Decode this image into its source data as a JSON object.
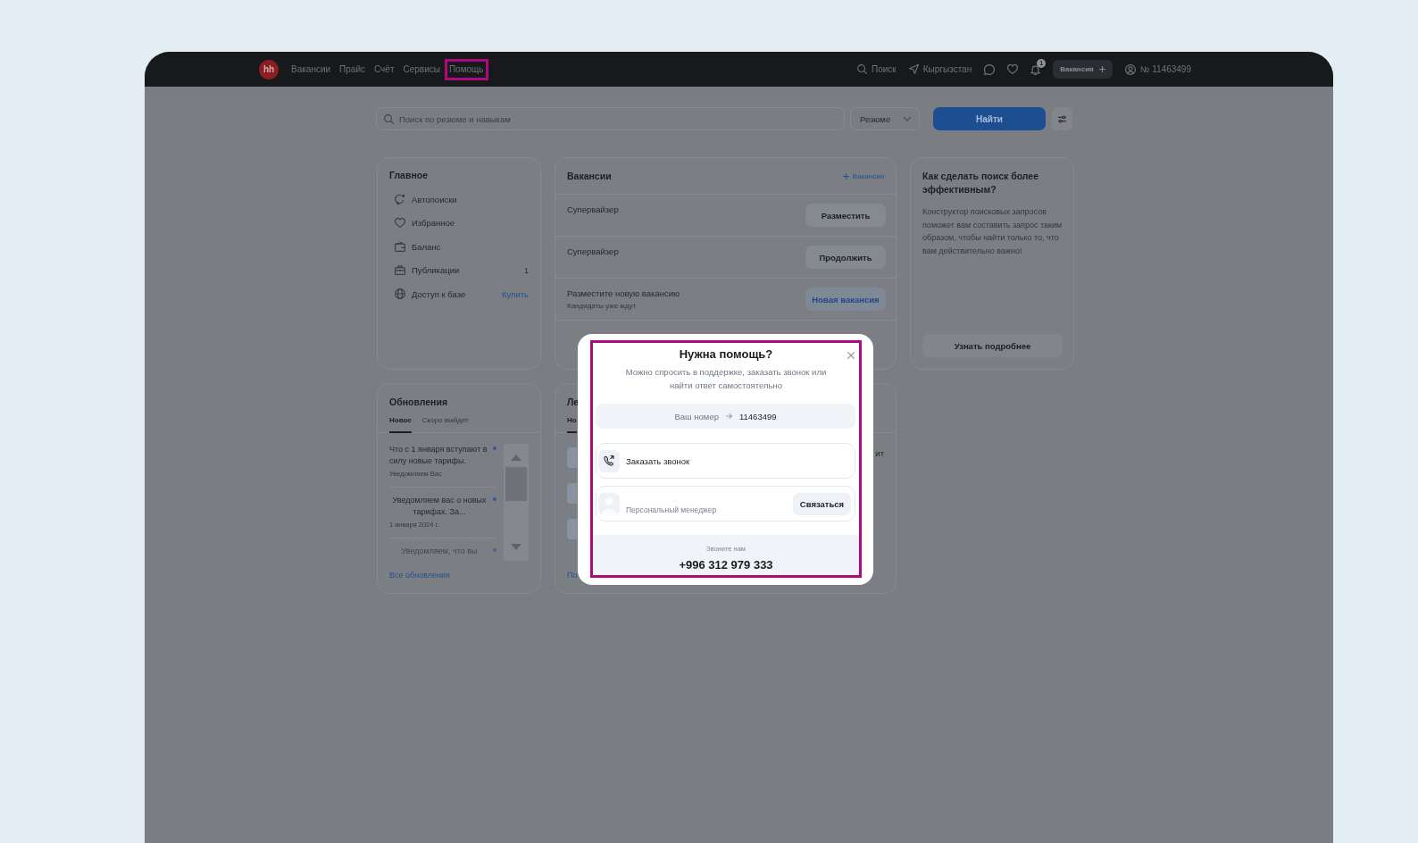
{
  "header": {
    "logo": "hh",
    "nav": [
      {
        "label": "Вакансии",
        "highlighted": false
      },
      {
        "label": "Прайс",
        "highlighted": false
      },
      {
        "label": "Счёт",
        "highlighted": false
      },
      {
        "label": "Сервисы",
        "highlighted": false
      },
      {
        "label": "Помощь",
        "highlighted": true
      }
    ],
    "search": "Поиск",
    "region": "Кыргызстан",
    "notification_count": "1",
    "vacancy_button": "Вакансия",
    "account": "№ 11463499"
  },
  "search": {
    "placeholder": "Поиск по резюме и навыкам",
    "type": "Резюме",
    "submit": "Найти"
  },
  "main_card": {
    "title": "Главное",
    "items": [
      {
        "label": "Автопоиски"
      },
      {
        "label": "Избранное"
      },
      {
        "label": "Баланс"
      },
      {
        "label": "Публикации",
        "count": "1"
      },
      {
        "label": "Доступ к базе",
        "action": "Купить"
      }
    ]
  },
  "vacancies_card": {
    "title": "Вакансии",
    "add_link": "Вакансия",
    "rows": [
      {
        "title": "Супервайзер",
        "button": "Разместить",
        "accent": false
      },
      {
        "title": "Супервайзер",
        "button": "Продолжить",
        "accent": false
      },
      {
        "title": "Разместите новую вакансию",
        "subtitle": "Кандидаты уже ждут",
        "button": "Новая вакансия",
        "accent": true
      }
    ]
  },
  "tip_card": {
    "title": "Как сделать поиск более эффективным?",
    "text": "Конструктор поисковых запросов поможет вам составить запрос таким образом, чтобы найти только то, что вам действительно важно!",
    "button": "Узнать подробнее"
  },
  "updates_card": {
    "title": "Обновления",
    "tabs": [
      {
        "label": "Новое",
        "selected": true
      },
      {
        "label": "Скоро выйдет",
        "selected": false
      }
    ],
    "items": [
      {
        "title": "Что с 1 января вступают в силу новые тарифы.",
        "subtitle": "Уведомляем Вас",
        "unread": true,
        "centered": false
      },
      {
        "title": "Уведомляем вас о новых тарифах. За...",
        "subtitle": "1 января 2024 г.",
        "unread": true,
        "centered": true
      },
      {
        "title": "Уведомляем, что вы",
        "unread": true,
        "centered": true
      }
    ],
    "link": "Все обновления"
  },
  "feed_card": {
    "title": "Ле",
    "tabs": [
      {
        "label": "Но",
        "selected": true
      }
    ],
    "side_text": "ит",
    "link": "По"
  },
  "help_modal": {
    "highlighted": true,
    "title": "Нужна помощь?",
    "subtitle": "Можно спросить в поддержке, заказать звонок или найти ответ самостоятельно",
    "number_label": "Ваш номер",
    "number": "11463499",
    "callback": "Заказать звонок",
    "manager_role": "Персональный менеджер",
    "manager_button": "Связаться",
    "footer_label": "Звоните нам",
    "phone": "+996 312 979 333"
  }
}
